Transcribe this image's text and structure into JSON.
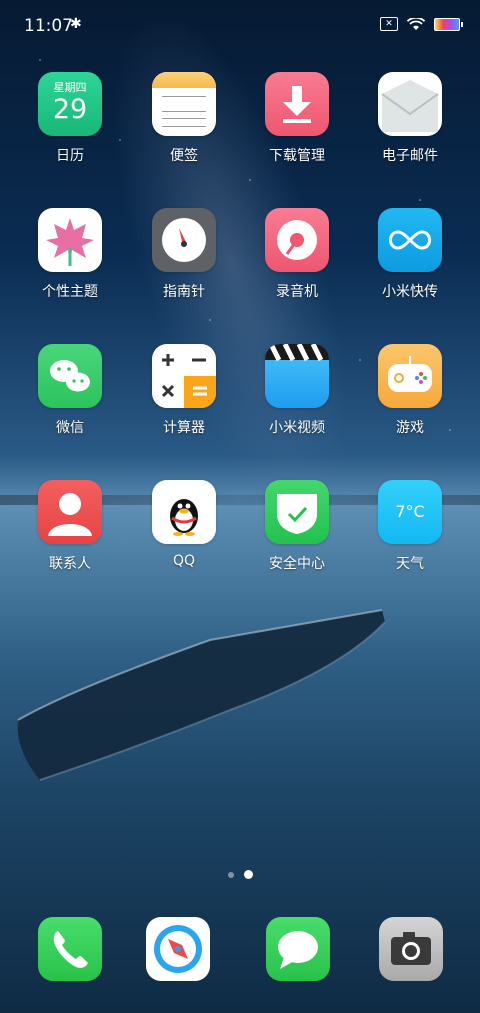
{
  "status_bar": {
    "time": "11:07"
  },
  "calendar_widget": {
    "weekday": "星期四",
    "day": "29"
  },
  "weather_widget": {
    "temp": "7°C"
  },
  "apps": [
    {
      "label": "日历"
    },
    {
      "label": "便签"
    },
    {
      "label": "下载管理"
    },
    {
      "label": "电子邮件"
    },
    {
      "label": "个性主题"
    },
    {
      "label": "指南针"
    },
    {
      "label": "录音机"
    },
    {
      "label": "小米快传"
    },
    {
      "label": "微信"
    },
    {
      "label": "计算器"
    },
    {
      "label": "小米视频"
    },
    {
      "label": "游戏"
    },
    {
      "label": "联系人"
    },
    {
      "label": "QQ"
    },
    {
      "label": "安全中心"
    },
    {
      "label": "天气"
    }
  ],
  "page_indicator": {
    "pages": 2,
    "current": 2
  },
  "dock": [
    "phone",
    "browser",
    "messages",
    "camera"
  ]
}
